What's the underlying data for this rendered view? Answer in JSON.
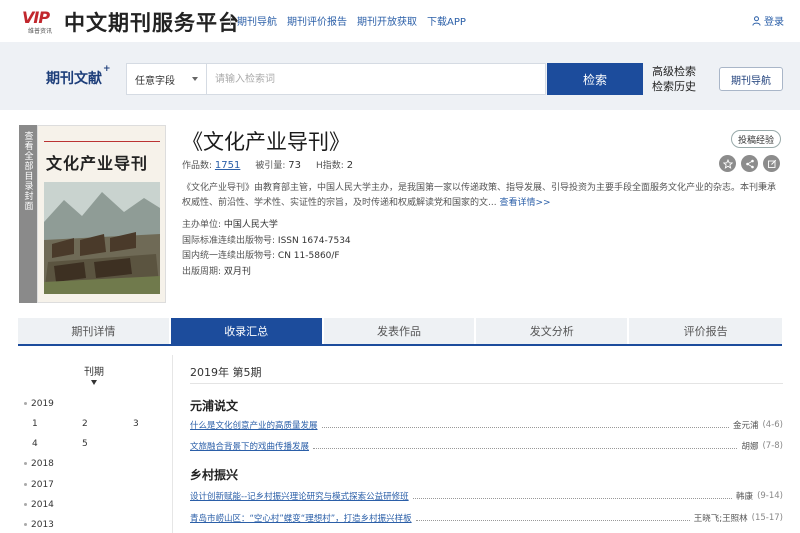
{
  "header": {
    "logo_text": "VIP",
    "logo_sub": "维普资讯",
    "site_title": "中文期刊服务平台",
    "nav": [
      "期刊导航",
      "期刊评价报告",
      "期刊开放获取",
      "下载APP"
    ],
    "login_label": "登录"
  },
  "search": {
    "brand": "期刊文献",
    "brand_mark": "+",
    "field_value": "任意字段",
    "placeholder": "请输入检索词",
    "button_label": "检索",
    "advanced_label": "高级检索",
    "history_label": "检索历史",
    "guide_button": "期刊导航"
  },
  "journal": {
    "cover_strip_text": "查看全部目录封面",
    "cover_title": "文化产业导刊",
    "title": "《文化产业导刊》",
    "submit_button": "投稿经验",
    "stats": {
      "works_label": "作品数:",
      "works_value": "1751",
      "cited_label": "被引量:",
      "cited_value": "73",
      "h_label": "H指数:",
      "h_value": "2"
    },
    "description": "《文化产业导刊》由教育部主管，中国人民大学主办，是我国第一家以传递政策、指导发展、引导投资为主要手段全面服务文化产业的杂志。本刊秉承权威性、前沿性、学术性、实证性的宗旨，及时传递和权威解读党和国家的文...",
    "more_label": "查看详情>>",
    "meta": [
      {
        "label": "主办单位:",
        "value": "中国人民大学"
      },
      {
        "label": "国际标准连续出版物号:",
        "value": "ISSN 1674-7534"
      },
      {
        "label": "国内统一连续出版物号:",
        "value": "CN 11-5860/F"
      },
      {
        "label": "出版周期:",
        "value": "双月刊"
      }
    ]
  },
  "tabs": [
    {
      "label": "期刊详情",
      "active": false
    },
    {
      "label": "收录汇总",
      "active": true
    },
    {
      "label": "发表作品",
      "active": false
    },
    {
      "label": "发文分析",
      "active": false
    },
    {
      "label": "评价报告",
      "active": false
    }
  ],
  "issues_panel": {
    "heading": "刊期",
    "year_2019": "2019",
    "issues_2019": [
      "1",
      "2",
      "3",
      "4",
      "5"
    ],
    "other_years": [
      "2018",
      "2017",
      "2014",
      "2013"
    ]
  },
  "contents": {
    "issue_label": "2019年 第5期",
    "sections": [
      {
        "title": "元浦说文",
        "articles": [
          {
            "title": "什么是文化创意产业的高质量发展",
            "author": "金元浦",
            "pages": "(4-6)"
          },
          {
            "title": "文旅融合背景下的戏曲传播发展",
            "author": "胡娜",
            "pages": "(7-8)"
          }
        ]
      },
      {
        "title": "乡村振兴",
        "articles": [
          {
            "title": "设计创新赋能--记乡村振兴理论研究与模式探索公益研修班",
            "author": "韩康",
            "pages": "(9-14)"
          },
          {
            "title": "青岛市崂山区：“空心村”蝶变“理想村”，打造乡村振兴样板",
            "author": "王晓飞;王照林",
            "pages": "(15-17)"
          }
        ]
      }
    ]
  },
  "colors": {
    "primary": "#1c4c9c",
    "link": "#2b5fa8",
    "search_bg": "#eef1f5"
  }
}
